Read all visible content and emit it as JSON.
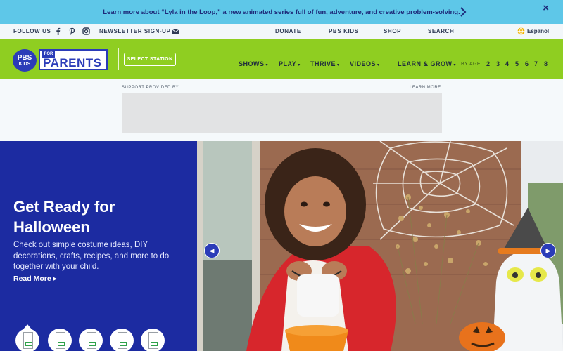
{
  "announcement": {
    "text": "Learn more about “Lyla in the Loop,” a new animated series full of fun, adventure, and creative problem-solving.",
    "close": "×"
  },
  "utility": {
    "follow_us": "FOLLOW US",
    "newsletter": "NEWSLETTER SIGN-UP",
    "donate": "DONATE",
    "pbs_kids": "PBS KIDS",
    "shop": "SHOP",
    "search": "SEARCH",
    "language": "Español",
    "icons": [
      "facebook-icon",
      "pinterest-icon",
      "instagram-icon",
      "mail-icon",
      "globe-icon"
    ]
  },
  "logo": {
    "pbs_line1": "PBS",
    "pbs_line2": "KIDS",
    "for": "FOR",
    "parents": "PARENTS"
  },
  "nav": {
    "select_station": "SELECT STATION",
    "items": [
      "SHOWS",
      "PLAY",
      "THRIVE",
      "VIDEOS"
    ],
    "learn_grow": "LEARN & GROW",
    "by_age": "BY AGE",
    "ages": [
      "2",
      "3",
      "4",
      "5",
      "6",
      "7",
      "8"
    ]
  },
  "sponsor": {
    "support": "SUPPORT PROVIDED BY:",
    "learn_more": "LEARN MORE"
  },
  "hero": {
    "title": "Get Ready for Halloween",
    "description": "Check out simple costume ideas, DIY decorations, crafts, recipes, and more to do together with your child.",
    "read_more": "Read More ▸",
    "prev": "◀",
    "next": "▶",
    "thumbnail_count": 5,
    "active_thumbnail": 1
  },
  "colors": {
    "announce_bg": "#5ec7e8",
    "nav_green": "#8fce21",
    "brand_blue": "#2b3cb8",
    "hero_blue": "#1c2ba1"
  }
}
